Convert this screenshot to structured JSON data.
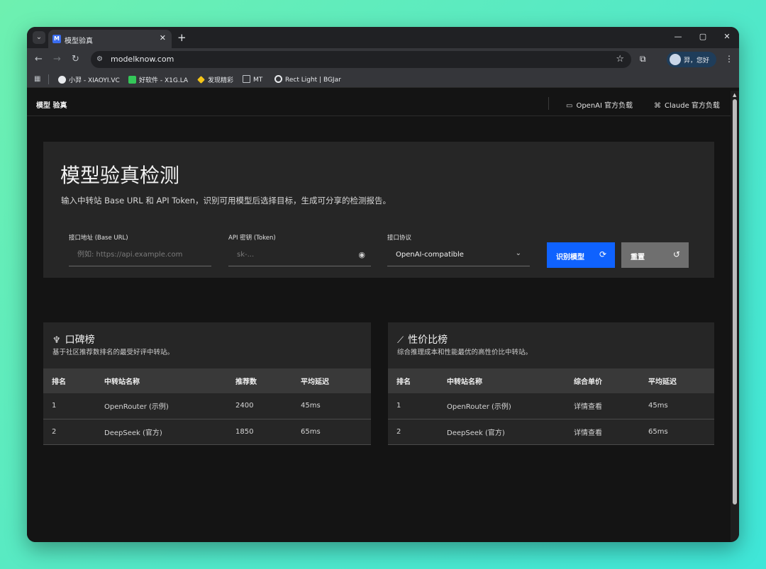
{
  "browser": {
    "tab_title": "模型验真",
    "tab_favicon_letter": "M",
    "tab_close": "✕",
    "new_tab": "+",
    "tab_search_icon": "chevron-down-icon",
    "url": "modelknow.com",
    "profile_label": "羿，您好",
    "window_controls": [
      "—",
      "▢",
      "✕"
    ],
    "bookmarks": [
      {
        "label": "小羿 - XIAOYI.VC",
        "icon_color": "#e8eaed"
      },
      {
        "label": "好软件 - X1G.LA",
        "icon_color": "#34c759"
      },
      {
        "label": "发现精彩",
        "icon_color": "#f5c518"
      },
      {
        "label": "MT",
        "icon_color": "#bdc1c6"
      },
      {
        "label": "Rect Light | BGJar",
        "icon_color": "#e8eaed"
      }
    ]
  },
  "header": {
    "brand": "模型 验真",
    "openai_link": "OpenAI 官方负载",
    "claude_link": "Claude 官方负载"
  },
  "hero": {
    "title": "模型验真检测",
    "subtitle": "输入中转站 Base URL 和 API Token，识别可用模型后选择目标，生成可分享的检测报告。",
    "base_url_label": "接口地址 (Base URL)",
    "base_url_placeholder": "例如: https://api.example.com",
    "token_label": "API 密钥 (Token)",
    "token_placeholder": "sk-...",
    "protocol_label": "接口协议",
    "protocol_value": "OpenAI-compatible",
    "identify_button": "识别模型",
    "reset_button": "重置"
  },
  "reputation": {
    "title": "口碑榜",
    "subtitle": "基于社区推荐数排名的最受好评中转站。",
    "columns": [
      "排名",
      "中转站名称",
      "推荐数",
      "平均延迟"
    ],
    "rows": [
      [
        "1",
        "OpenRouter (示例)",
        "2400",
        "45ms"
      ],
      [
        "2",
        "DeepSeek (官方)",
        "1850",
        "65ms"
      ]
    ]
  },
  "value": {
    "title": "性价比榜",
    "subtitle": "综合推理成本和性能最优的高性价比中转站。",
    "columns": [
      "排名",
      "中转站名称",
      "综合单价",
      "平均延迟"
    ],
    "rows": [
      [
        "1",
        "OpenRouter (示例)",
        "详情查看",
        "45ms"
      ],
      [
        "2",
        "DeepSeek (官方)",
        "详情查看",
        "65ms"
      ]
    ]
  },
  "colors": {
    "primary_button": "#0f62fe",
    "secondary_button": "#6f6f6f",
    "panel": "#262626",
    "background": "#141414"
  }
}
